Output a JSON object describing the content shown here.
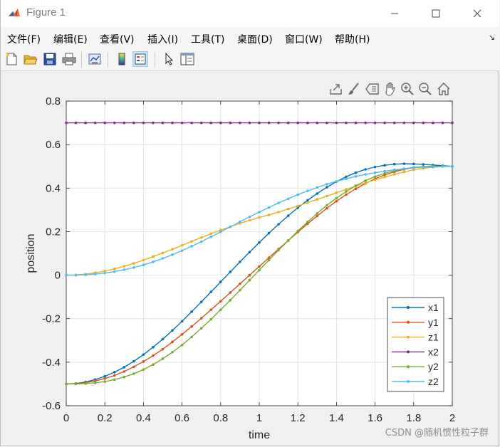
{
  "window": {
    "title": "Figure 1",
    "minimize_glyph": "—",
    "maximize_glyph": "☐",
    "close_glyph": "✕"
  },
  "menu": {
    "items": [
      "文件(F)",
      "编辑(E)",
      "查看(V)",
      "插入(I)",
      "工具(T)",
      "桌面(D)",
      "窗口(W)",
      "帮助(H)"
    ],
    "dock_glyph": "↘"
  },
  "toolbar": {
    "icons": [
      "new-figure-icon",
      "open-file-icon",
      "save-icon",
      "print-icon",
      "link-plot-icon",
      "colorbar-icon",
      "legend-icon",
      "pointer-icon",
      "property-inspector-icon"
    ]
  },
  "axes_toolbar": {
    "icons": [
      "export-icon",
      "brush-icon",
      "data-tip-icon",
      "pan-icon",
      "zoom-in-icon",
      "zoom-out-icon",
      "home-icon"
    ]
  },
  "watermark": "CSDN @随机惯性粒子群",
  "colors": {
    "x1": "#0072BD",
    "y1": "#D95319",
    "z1": "#EDB120",
    "x2": "#7E2F8E",
    "y2": "#77AC30",
    "z2": "#4DBEEE"
  },
  "chart_data": {
    "type": "line",
    "title": "",
    "xlabel": "time",
    "ylabel": "position",
    "xlim": [
      0,
      2
    ],
    "ylim": [
      -0.6,
      0.8
    ],
    "xticks": [
      "0",
      "0.2",
      "0.4",
      "0.6",
      "0.8",
      "1",
      "1.2",
      "1.4",
      "1.6",
      "1.8",
      "2"
    ],
    "yticks": [
      "-0.6",
      "-0.4",
      "-0.2",
      "0",
      "0.2",
      "0.4",
      "0.6",
      "0.8"
    ],
    "grid": true,
    "legend_position": "bottom-right",
    "marker": "dot",
    "x": [
      0,
      0.05,
      0.1,
      0.15,
      0.2,
      0.25,
      0.3,
      0.35,
      0.4,
      0.45,
      0.5,
      0.55,
      0.6,
      0.65,
      0.7,
      0.75,
      0.8,
      0.85,
      0.9,
      0.95,
      1.0,
      1.05,
      1.1,
      1.15,
      1.2,
      1.25,
      1.3,
      1.35,
      1.4,
      1.45,
      1.5,
      1.55,
      1.6,
      1.65,
      1.7,
      1.75,
      1.8,
      1.85,
      1.9,
      1.95,
      2.0
    ],
    "series": [
      {
        "name": "x1",
        "values": [
          -0.5,
          -0.498,
          -0.491,
          -0.48,
          -0.465,
          -0.446,
          -0.423,
          -0.396,
          -0.365,
          -0.331,
          -0.294,
          -0.254,
          -0.212,
          -0.168,
          -0.123,
          -0.077,
          -0.031,
          0.015,
          0.061,
          0.106,
          0.15,
          0.193,
          0.234,
          0.273,
          0.31,
          0.344,
          0.375,
          0.404,
          0.43,
          0.452,
          0.471,
          0.486,
          0.497,
          0.505,
          0.51,
          0.512,
          0.511,
          0.509,
          0.506,
          0.503,
          0.5
        ]
      },
      {
        "name": "y1",
        "values": [
          -0.5,
          -0.499,
          -0.494,
          -0.486,
          -0.475,
          -0.461,
          -0.443,
          -0.421,
          -0.397,
          -0.37,
          -0.34,
          -0.307,
          -0.272,
          -0.236,
          -0.198,
          -0.159,
          -0.12,
          -0.08,
          -0.04,
          0.0,
          0.04,
          0.08,
          0.12,
          0.159,
          0.198,
          0.236,
          0.272,
          0.307,
          0.34,
          0.37,
          0.397,
          0.421,
          0.443,
          0.461,
          0.475,
          0.486,
          0.494,
          0.499,
          0.5,
          0.5,
          0.5
        ]
      },
      {
        "name": "z1",
        "values": [
          0.0,
          0.001,
          0.005,
          0.011,
          0.019,
          0.029,
          0.041,
          0.054,
          0.069,
          0.085,
          0.102,
          0.119,
          0.137,
          0.155,
          0.173,
          0.19,
          0.207,
          0.223,
          0.238,
          0.252,
          0.265,
          0.277,
          0.29,
          0.304,
          0.318,
          0.333,
          0.348,
          0.363,
          0.379,
          0.394,
          0.409,
          0.424,
          0.438,
          0.451,
          0.463,
          0.474,
          0.484,
          0.491,
          0.496,
          0.499,
          0.5
        ]
      },
      {
        "name": "x2",
        "values": [
          0.7,
          0.7,
          0.7,
          0.7,
          0.7,
          0.7,
          0.7,
          0.7,
          0.7,
          0.7,
          0.7,
          0.7,
          0.7,
          0.7,
          0.7,
          0.7,
          0.7,
          0.7,
          0.7,
          0.7,
          0.7,
          0.7,
          0.7,
          0.7,
          0.7,
          0.7,
          0.7,
          0.7,
          0.7,
          0.7,
          0.7,
          0.7,
          0.7,
          0.7,
          0.7,
          0.7,
          0.7,
          0.7,
          0.7,
          0.7,
          0.7
        ]
      },
      {
        "name": "y2",
        "values": [
          -0.5,
          -0.5,
          -0.498,
          -0.495,
          -0.489,
          -0.48,
          -0.468,
          -0.453,
          -0.434,
          -0.411,
          -0.384,
          -0.354,
          -0.321,
          -0.284,
          -0.244,
          -0.203,
          -0.159,
          -0.115,
          -0.069,
          -0.023,
          0.023,
          0.069,
          0.115,
          0.159,
          0.203,
          0.244,
          0.284,
          0.321,
          0.354,
          0.384,
          0.411,
          0.434,
          0.453,
          0.468,
          0.48,
          0.489,
          0.495,
          0.498,
          0.5,
          0.5,
          0.5
        ]
      },
      {
        "name": "z2",
        "values": [
          0.0,
          0.0,
          0.002,
          0.005,
          0.01,
          0.016,
          0.025,
          0.035,
          0.047,
          0.061,
          0.077,
          0.094,
          0.113,
          0.133,
          0.154,
          0.176,
          0.199,
          0.222,
          0.245,
          0.268,
          0.29,
          0.311,
          0.332,
          0.351,
          0.37,
          0.387,
          0.403,
          0.418,
          0.431,
          0.443,
          0.454,
          0.463,
          0.471,
          0.478,
          0.484,
          0.489,
          0.493,
          0.496,
          0.498,
          0.5,
          0.5
        ]
      }
    ]
  }
}
